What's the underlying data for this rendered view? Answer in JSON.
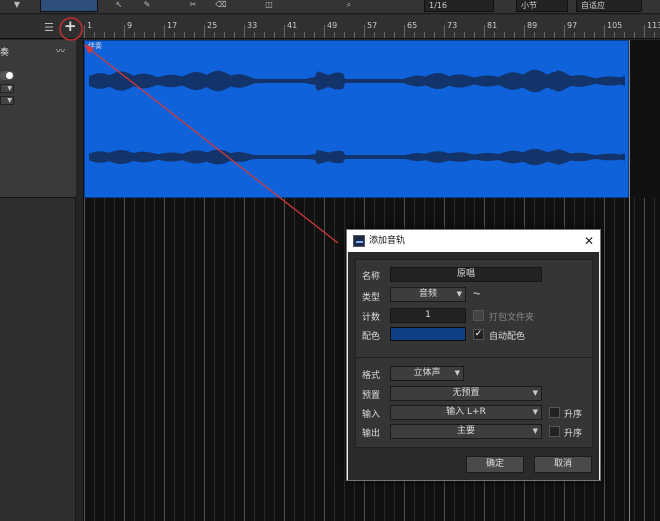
{
  "toolbar": {
    "snap_value": "1/16",
    "timebase": "小节",
    "snap_mode": "自适应"
  },
  "ruler": {
    "marks": [
      "1",
      "9",
      "17",
      "25",
      "33",
      "41",
      "49",
      "57",
      "65",
      "73",
      "81",
      "89",
      "97",
      "105",
      "113"
    ]
  },
  "track": {
    "name_fragment": "奏",
    "clip_label": "伴奏"
  },
  "dialog": {
    "title": "添加音轨",
    "close_glyph": "✕",
    "name_label": "名称",
    "name_value": "原唱",
    "type_label": "类型",
    "type_value": "音频",
    "type_icon_glyph": "⏦",
    "count_label": "计数",
    "count_value": "1",
    "pack_folder_label": "打包文件夹",
    "color_label": "配色",
    "color_value": "#0e3f85",
    "auto_color_label": "自动配色",
    "auto_color_checked": true,
    "format_label": "格式",
    "format_value": "立体声",
    "preset_label": "预置",
    "preset_value": "无预置",
    "input_label": "输入",
    "input_value": "输入 L+R",
    "input_ascend_label": "升序",
    "output_label": "输出",
    "output_value": "主要",
    "output_ascend_label": "升序",
    "ok_label": "确定",
    "cancel_label": "取消"
  },
  "icons": {
    "add_track": "+",
    "list": "☰",
    "waveform": "〰",
    "dropdown_arrow": "▼"
  }
}
